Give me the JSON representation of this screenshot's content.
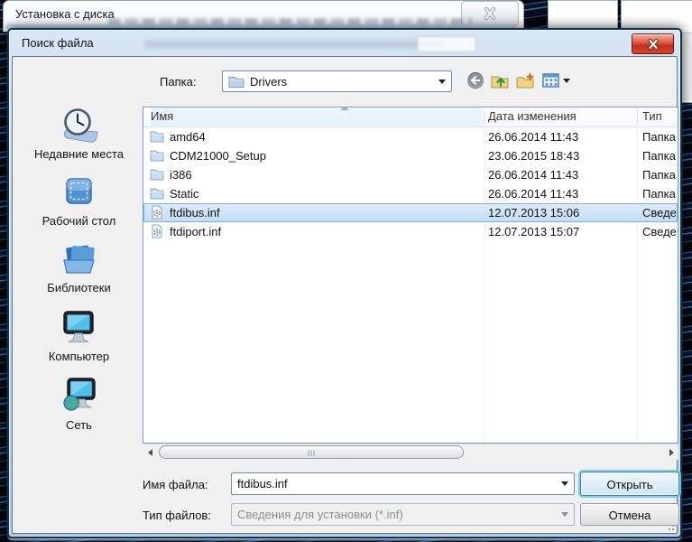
{
  "bg": {
    "title": "Установка с диска"
  },
  "dlg": {
    "title": "Поиск файла",
    "folder": {
      "label": "Папка:",
      "value": "Drivers"
    },
    "sidebar": [
      {
        "label": "Недавние места"
      },
      {
        "label": "Рабочий стол"
      },
      {
        "label": "Библиотеки"
      },
      {
        "label": "Компьютер"
      },
      {
        "label": "Сеть"
      }
    ],
    "list": {
      "columns": {
        "name": "Имя",
        "date": "Дата изменения",
        "type": "Тип"
      },
      "rows": [
        {
          "name": "amd64",
          "date": "26.06.2014 11:43",
          "type": "Папка",
          "kind": "folder",
          "selected": false
        },
        {
          "name": "CDM21000_Setup",
          "date": "23.06.2015 18:43",
          "type": "Папка",
          "kind": "folder",
          "selected": false
        },
        {
          "name": "i386",
          "date": "26.06.2014 11:43",
          "type": "Папка",
          "kind": "folder",
          "selected": false
        },
        {
          "name": "Static",
          "date": "26.06.2014 11:43",
          "type": "Папка",
          "kind": "folder",
          "selected": false
        },
        {
          "name": "ftdibus.inf",
          "date": "12.07.2013 15:06",
          "type": "Сведе",
          "kind": "inf",
          "selected": true
        },
        {
          "name": "ftdiport.inf",
          "date": "12.07.2013 15:07",
          "type": "Сведе",
          "kind": "inf",
          "selected": false
        }
      ]
    },
    "fields": {
      "filename_label": "Имя файла:",
      "filename_value": "ftdibus.inf",
      "filetype_label": "Тип файлов:",
      "filetype_value": "Сведения для установки (*.inf)"
    },
    "buttons": {
      "open": "Открыть",
      "cancel": "Отмена"
    }
  },
  "colors": {
    "titlebar_glass": "#b9d1ea",
    "client_gray": "#f0f0f0",
    "selection_blue": "#c3dcf5",
    "selection_border": "#7fb0df",
    "close_red": "#bf3122",
    "focus_glow": "#6ec8e4"
  }
}
